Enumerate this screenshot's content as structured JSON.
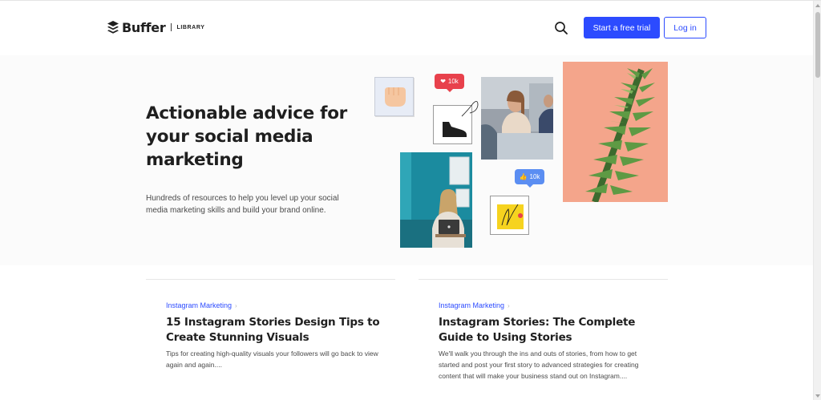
{
  "header": {
    "logo_text": "Buffer",
    "logo_section": "LIBRARY",
    "search_icon": "search-icon",
    "trial_button": "Start a free trial",
    "login_button": "Log in",
    "accent_color": "#2c4bff"
  },
  "hero": {
    "title": "Actionable advice for your social media marketing",
    "subtitle": "Hundreds of resources to help you level up your social media marketing skills and build your brand online.",
    "badges": {
      "heart_count": "10k",
      "like_count": "10k"
    }
  },
  "articles": [
    {
      "category": "Instagram Marketing",
      "title": "15 Instagram Stories Design Tips to Create Stunning Visuals",
      "description": "Tips for creating high-quality visuals your followers will go back to view again and again...."
    },
    {
      "category": "Instagram Marketing",
      "title": "Instagram Stories: The Complete Guide to Using Stories",
      "description": "We'll walk you through the ins and outs of stories, from how to get started and post your first story to advanced strategies for creating content that will make your business stand out on Instagram...."
    }
  ]
}
